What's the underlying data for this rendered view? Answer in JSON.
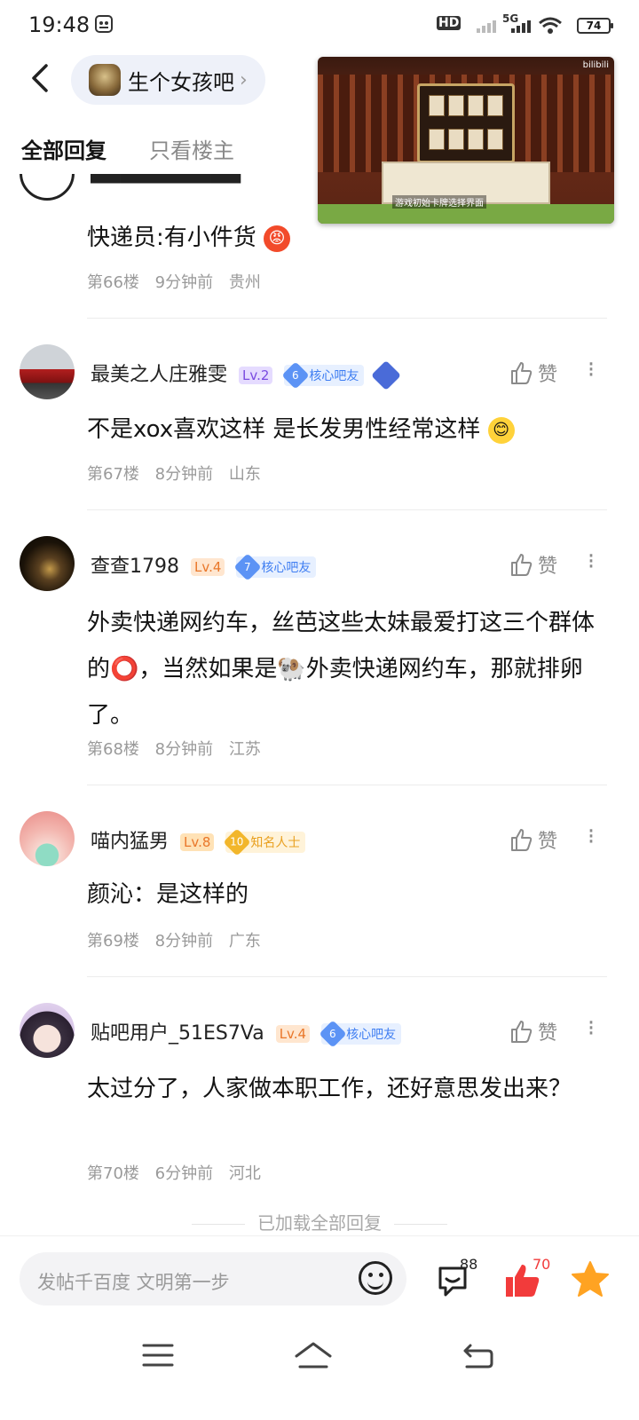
{
  "status": {
    "time": "19:48",
    "battery": "74",
    "hd": "HD",
    "net": "5G"
  },
  "header": {
    "forum_name": "生个女孩吧"
  },
  "tabs": {
    "all": "全部回复",
    "op_only": "只看楼主"
  },
  "video_overlay": {
    "logo": "bilibili",
    "caption": "游戏初始卡牌选择界面"
  },
  "partial_post": {
    "content": "快递员:有小件货",
    "floor": "第66楼",
    "time": "9分钟前",
    "location": "贵州"
  },
  "posts": [
    {
      "username": "最美之人庄雅雯",
      "level": "Lv.2",
      "badge_num": "6",
      "badge_label": "核心吧友",
      "content": "不是xox喜欢这样 是长发男性经常这样",
      "floor": "第67楼",
      "time": "8分钟前",
      "location": "山东",
      "like": "赞"
    },
    {
      "username": "查查1798",
      "level": "Lv.4",
      "badge_num": "7",
      "badge_label": "核心吧友",
      "content": "外卖快递网约车，丝芭这些太妹最爱打这三个群体的⭕，当然如果是🐏外卖快递网约车，那就排卵了。",
      "floor": "第68楼",
      "time": "8分钟前",
      "location": "江苏",
      "like": "赞"
    },
    {
      "username": "喵内猛男",
      "level": "Lv.8",
      "badge_num": "10",
      "badge_label": "知名人士",
      "content": "颜沁：是这样的",
      "floor": "第69楼",
      "time": "8分钟前",
      "location": "广东",
      "like": "赞"
    },
    {
      "username": "贴吧用户_51ES7Va",
      "level": "Lv.4",
      "badge_num": "6",
      "badge_label": "核心吧友",
      "content": "太过分了，人家做本职工作，还好意思发出来？",
      "floor": "第70楼",
      "time": "6分钟前",
      "location": "河北",
      "like": "赞"
    }
  ],
  "footer": {
    "all_loaded": "已加载全部回复"
  },
  "bottom": {
    "placeholder": "发帖千百度 文明第一步",
    "comment_count": "88",
    "like_count": "70"
  },
  "colors": {
    "accent_blue": "#4d7cf5",
    "like_red": "#f23b3b",
    "star_orange": "#ffa322"
  }
}
